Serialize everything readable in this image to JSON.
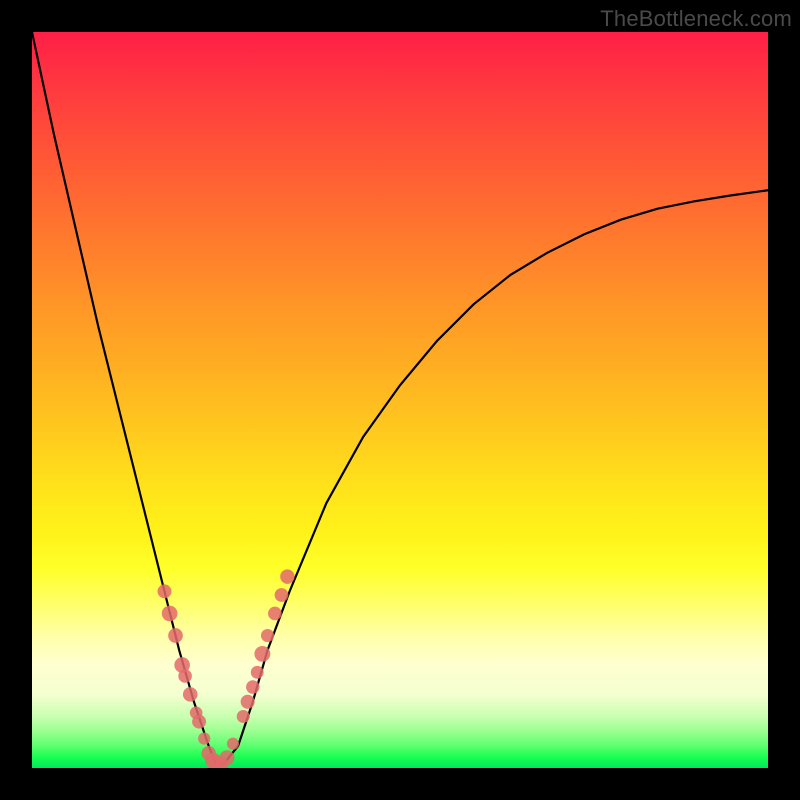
{
  "watermark": "TheBottleneck.com",
  "colors": {
    "frame": "#000000",
    "curve": "#000000",
    "point_fill": "#e36a6a",
    "point_stroke": "#d45a5a"
  },
  "chart_data": {
    "type": "line",
    "title": "",
    "xlabel": "",
    "ylabel": "",
    "xlim": [
      0,
      100
    ],
    "ylim": [
      0,
      100
    ],
    "grid": false,
    "note": "Bottleneck-style V curve; y≈0 is green bottom, y=100 is red top. Minimum near x≈25.",
    "series": [
      {
        "name": "bottleneck_curve",
        "x": [
          0,
          3,
          6,
          9,
          12,
          15,
          18,
          20,
          22,
          24,
          25,
          26,
          28,
          30,
          32,
          35,
          40,
          45,
          50,
          55,
          60,
          65,
          70,
          75,
          80,
          85,
          90,
          95,
          100
        ],
        "y": [
          100,
          86,
          73,
          60,
          48,
          36,
          24,
          16,
          9,
          3,
          0.5,
          0.5,
          3,
          9,
          16,
          24,
          36,
          45,
          52,
          58,
          63,
          67,
          70,
          72.5,
          74.5,
          76,
          77,
          77.8,
          78.5
        ]
      }
    ],
    "points": {
      "name": "highlighted_region",
      "note": "pink/coral dots clustered along both arms near the minimum",
      "x": [
        18.0,
        18.7,
        19.5,
        20.4,
        20.8,
        21.5,
        22.3,
        22.7,
        23.4,
        24.0,
        24.6,
        25.2,
        25.8,
        26.5,
        27.3,
        28.7,
        29.3,
        30.0,
        30.6,
        31.3,
        32.0,
        33.0,
        33.9,
        34.7
      ],
      "y": [
        24.0,
        21.0,
        18.0,
        14.0,
        12.5,
        10.0,
        7.5,
        6.3,
        4.0,
        2.0,
        1.0,
        0.6,
        0.6,
        1.4,
        3.3,
        7.0,
        9.0,
        11.0,
        13.0,
        15.5,
        18.0,
        21.0,
        23.5,
        26.0
      ]
    }
  }
}
